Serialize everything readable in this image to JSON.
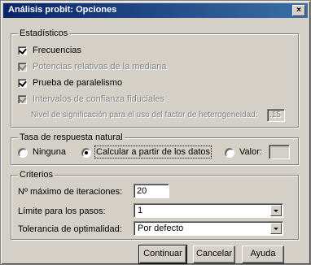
{
  "window": {
    "title": "Análisis probit: Opciones",
    "close_glyph": "×"
  },
  "estadisticos": {
    "legend": "Estadísticos",
    "frecuencias": "Frecuencias",
    "potencias": "Potencias relativas de la mediana",
    "paralelismo": "Prueba de paralelismo",
    "fiduciales": "Intervalos de confianza fiduciales",
    "heterogeneidad": "Nivel de significación para el uso del factor de heterogeneidad:",
    "heterogeneidad_value": ".15"
  },
  "tasa": {
    "legend": "Tasa de respuesta natural",
    "ninguna": "Ninguna",
    "calcular": "Calcular a partir de los datos",
    "valor": "Valor:",
    "valor_value": ""
  },
  "criterios": {
    "legend": "Criterios",
    "max_iter_label": "Nº máximo de iteraciones:",
    "max_iter_value": "20",
    "limite_label": "Límite para los pasos:",
    "limite_value": "1",
    "tolerancia_label": "Tolerancia de optimalidad:",
    "tolerancia_value": "Por defecto"
  },
  "buttons": {
    "continuar": "Continuar",
    "cancelar": "Cancelar",
    "ayuda": "Ayuda"
  }
}
